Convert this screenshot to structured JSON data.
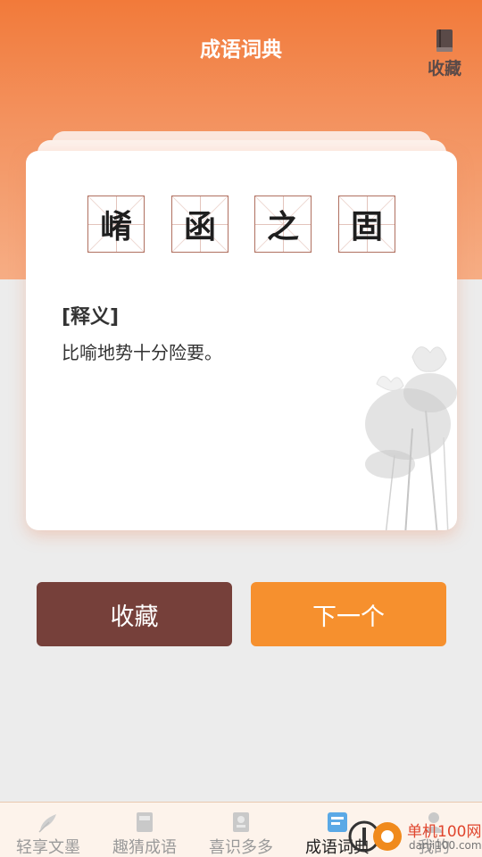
{
  "header": {
    "title": "成语词典",
    "favorites_label": "收藏"
  },
  "idiom": {
    "characters": [
      "崤",
      "函",
      "之",
      "固"
    ],
    "meaning_label": "[释义]",
    "meaning_text": "比喻地势十分险要。"
  },
  "actions": {
    "favorite_label": "收藏",
    "next_label": "下一个"
  },
  "tabbar": {
    "items": [
      {
        "label": "轻享文墨",
        "icon": "feather-icon",
        "active": false
      },
      {
        "label": "趣猜成语",
        "icon": "book-icon",
        "active": false
      },
      {
        "label": "喜识多多",
        "icon": "reader-icon",
        "active": false
      },
      {
        "label": "成语词典",
        "icon": "idiom-dictionary-icon",
        "active": true
      },
      {
        "label": "我的",
        "icon": "profile-icon",
        "active": false
      }
    ]
  },
  "watermark": {
    "line1": "单机100网",
    "line2": "danji100.com"
  },
  "colors": {
    "header_orange": "#f27a3a",
    "favorite_button": "#76403a",
    "next_button": "#f6902e"
  }
}
